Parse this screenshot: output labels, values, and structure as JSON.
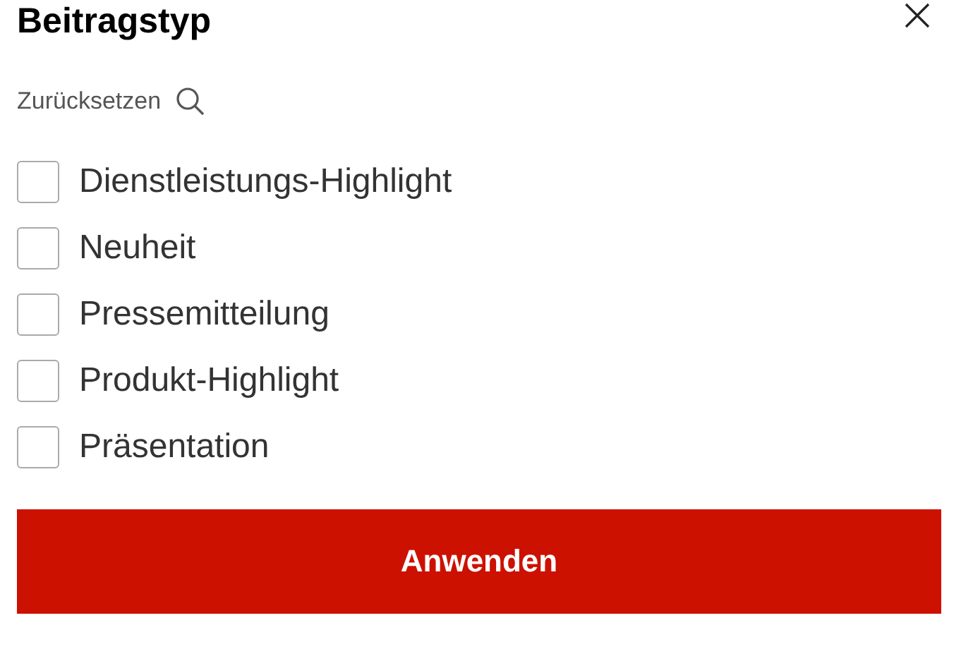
{
  "title": "Beitragstyp",
  "reset": {
    "label": "Zurücksetzen"
  },
  "options": [
    {
      "label": "Dienstleistungs-Highlight",
      "checked": false
    },
    {
      "label": "Neuheit",
      "checked": false
    },
    {
      "label": "Pressemitteilung",
      "checked": false
    },
    {
      "label": "Produkt-Highlight",
      "checked": false
    },
    {
      "label": "Präsentation",
      "checked": false
    }
  ],
  "apply_button": "Anwenden"
}
